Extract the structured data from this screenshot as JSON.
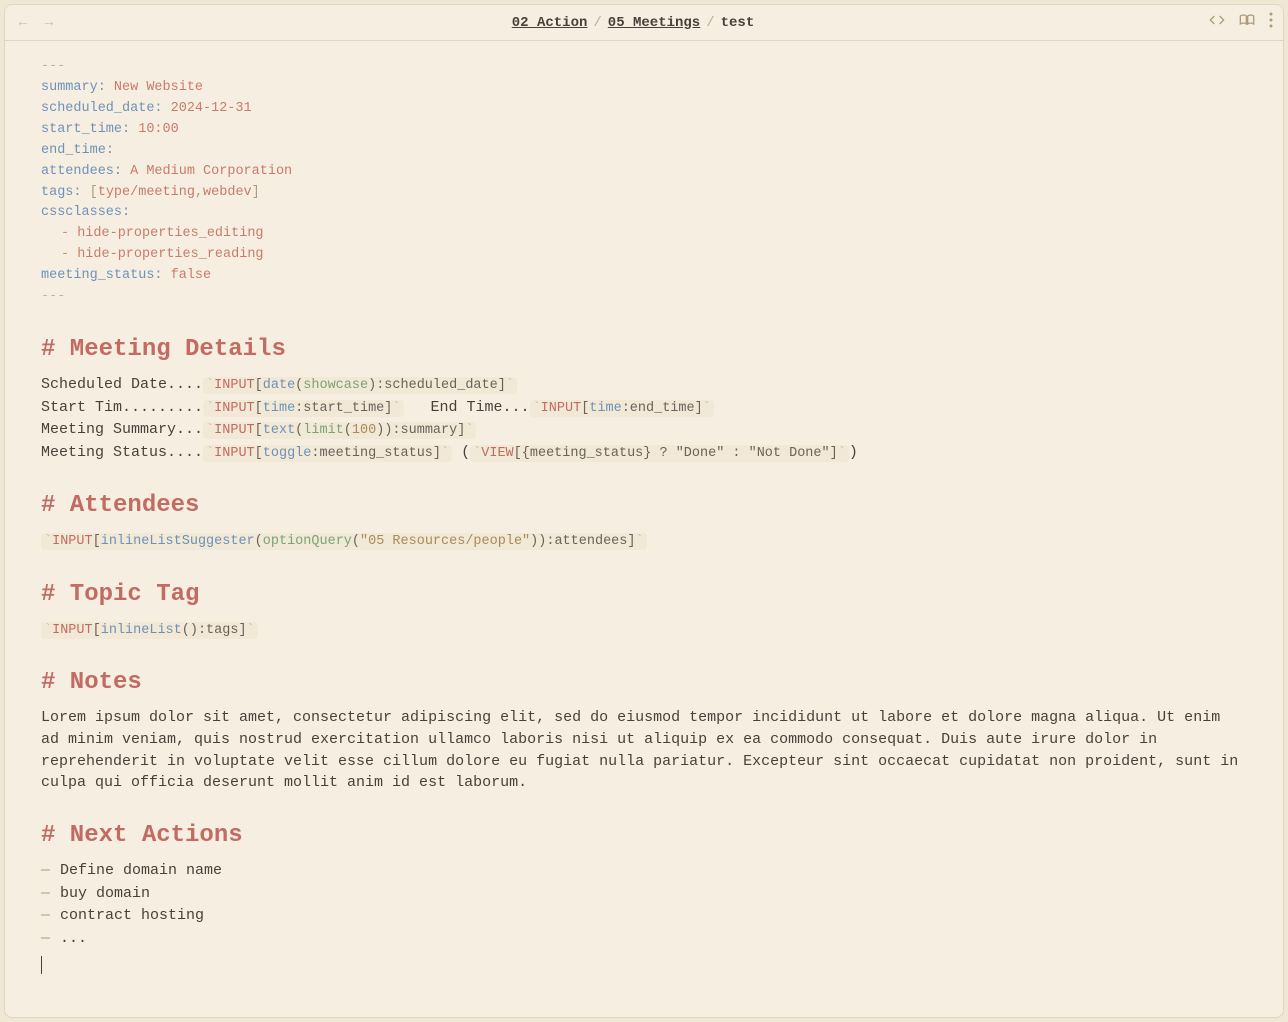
{
  "breadcrumb": {
    "a": "02 Action",
    "b": "05 Meetings",
    "current": "test"
  },
  "frontmatter": {
    "dashes": "---",
    "summary_k": "summary",
    "summary_v": "New Website",
    "sched_k": "scheduled_date",
    "sched_v": "2024-12-31",
    "start_k": "start_time",
    "start_v": "10:00",
    "end_k": "end_time",
    "end_v": "",
    "att_k": "attendees",
    "att_v": "A Medium Corporation",
    "tags_k": "tags",
    "tags_open": "[",
    "tags_1": "type/meeting",
    "tags_comma": ",",
    "tags_2": "webdev",
    "tags_close": "]",
    "css_k": "cssclasses",
    "css_1": "hide-properties_editing",
    "css_2": "hide-properties_reading",
    "ms_k": "meeting_status",
    "ms_v": "false"
  },
  "sections": {
    "details": "# Meeting Details",
    "attendees": "# Attendees",
    "topic": "# Topic Tag",
    "notes": "# Notes",
    "next": "# Next Actions"
  },
  "details": {
    "l1_label": "Scheduled Date....",
    "l1_code_pre": "INPUT",
    "l1_fn": "date",
    "l1_arg": "showcase",
    "l1_field": ":scheduled_date",
    "l2_label": "Start Tim.........",
    "l2_code_pre": "INPUT",
    "l2_fn": "time",
    "l2_field": ":start_time",
    "l2b_label": "End Time...",
    "l2b_code_pre": "INPUT",
    "l2b_fn": "time",
    "l2b_field": ":end_time",
    "l3_label": "Meeting Summary...",
    "l3_code_pre": "INPUT",
    "l3_fn": "text",
    "l3_inner_fn": "limit",
    "l3_inner_arg": "100",
    "l3_field": ":summary",
    "l4_label": "Meeting Status....",
    "l4_code_pre": "INPUT",
    "l4_fn": "toggle",
    "l4_field": ":meeting_status",
    "l4_view_pre": "VIEW",
    "l4_view_expr": "{meeting_status} ? \"Done\" : \"Not Done\"",
    "paren_open": " (",
    "paren_close": ")"
  },
  "attendees_code": {
    "pre": "INPUT",
    "fn": "inlineListSuggester",
    "inner_fn": "optionQuery",
    "inner_arg": "\"05 Resources/people\"",
    "field": ":attendees"
  },
  "topic_code": {
    "pre": "INPUT",
    "fn": "inlineList",
    "field": ":tags"
  },
  "notes_text": "Lorem ipsum dolor sit amet, consectetur adipiscing elit, sed do eiusmod tempor incididunt ut labore et dolore magna aliqua. Ut enim ad minim veniam, quis nostrud exercitation ullamco laboris nisi ut aliquip ex ea commodo consequat. Duis aute irure dolor in reprehenderit in voluptate velit esse cillum dolore eu fugiat nulla pariatur. Excepteur sint occaecat cupidatat non proident, sunt in culpa qui officia deserunt mollit anim id est laborum.",
  "next_actions": {
    "a": "Define domain name",
    "b": "buy domain",
    "c": "contract hosting",
    "d": "..."
  }
}
